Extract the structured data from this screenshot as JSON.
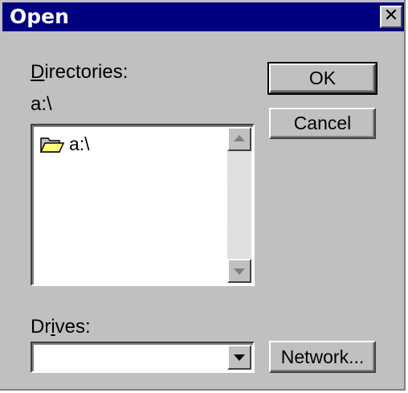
{
  "window": {
    "title": "Open",
    "close_glyph": "✕"
  },
  "directories": {
    "label_pre": "",
    "label_mnemonic": "D",
    "label_post": "irectories:",
    "current_path": "a:\\",
    "items": [
      {
        "name": "a:\\",
        "icon": "open-folder-icon"
      }
    ]
  },
  "drives": {
    "label_pre": "Dr",
    "label_mnemonic": "i",
    "label_post": "ves:",
    "selected": ""
  },
  "buttons": {
    "ok": "OK",
    "cancel": "Cancel",
    "network": "Network..."
  }
}
